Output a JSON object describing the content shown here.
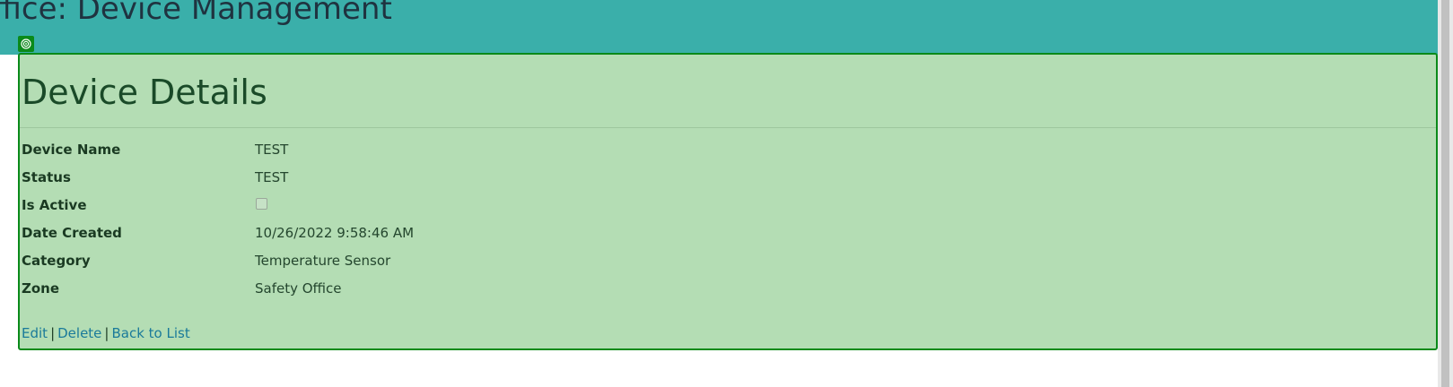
{
  "header": {
    "title": "ffice: Device Management"
  },
  "details": {
    "title": "Device Details",
    "fields": [
      {
        "label": "Device Name",
        "value": "TEST"
      },
      {
        "label": "Status",
        "value": "TEST"
      },
      {
        "label": "Is Active",
        "value": false
      },
      {
        "label": "Date Created",
        "value": "10/26/2022 9:58:46 AM"
      },
      {
        "label": "Category",
        "value": "Temperature Sensor"
      },
      {
        "label": "Zone",
        "value": "Safety Office"
      }
    ]
  },
  "actions": {
    "edit": "Edit",
    "separator": "|",
    "delete": "Delete",
    "back": "Back to List"
  },
  "colors": {
    "header_bg": "#3aafaa",
    "panel_bg": "#b4ddb4",
    "panel_border": "#0a8a1a",
    "link": "#1a7a9a"
  },
  "icons": {
    "inspect_badge": "target-icon"
  }
}
